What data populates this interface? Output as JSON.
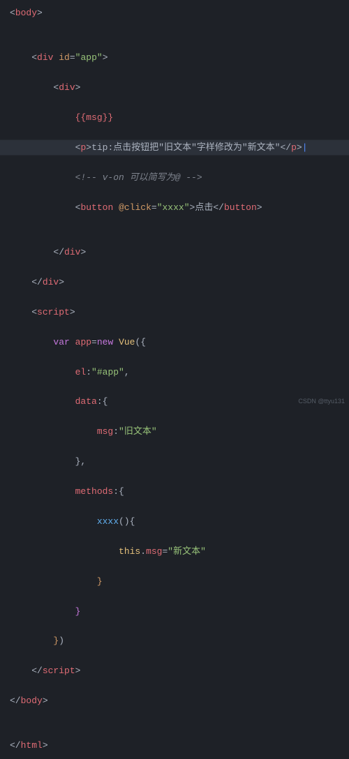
{
  "code": {
    "l1_tag": "body",
    "l2_tag": "div",
    "l2_attr": "id",
    "l2_val": "\"app\"",
    "l3_tag": "div",
    "l4_expr": "{{msg}}",
    "l5_tag": "p",
    "l5_text": "tip:点击按钮把\"旧文本\"字样修改为\"新文本\"",
    "l6_comment": "<!-- v-on 可以简写为@ -->",
    "l7_tag": "button",
    "l7_attr": "@click",
    "l7_val": "\"xxxx\"",
    "l7_text": "点击",
    "l9_script": "script",
    "l10_kw": "var",
    "l10_name": "app",
    "l10_op": "=",
    "l10_new": "new",
    "l10_cls": "Vue",
    "l11_key": "el",
    "l11_val": "\"#app\"",
    "l12_key": "data",
    "l13_key": "msg",
    "l13_val": "\"旧文本\"",
    "l15_key": "methods",
    "l16_fn": "xxxx",
    "l17_this": "this",
    "l17_prop": "msg",
    "l17_val": "\"新文本\"",
    "l24_html": "html"
  },
  "watermark": "CSDN @ttyu131"
}
